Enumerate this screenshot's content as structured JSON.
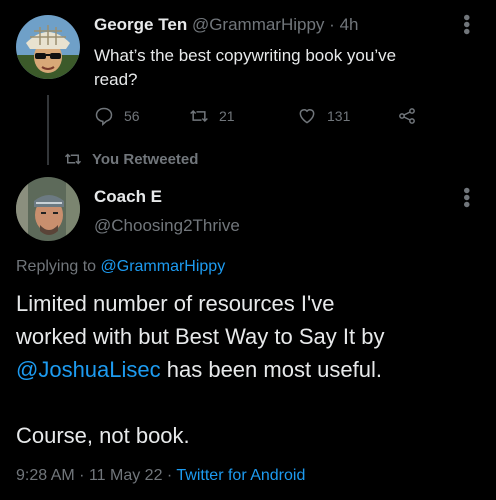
{
  "original_tweet": {
    "display_name": "George Ten",
    "handle": "@GrammarHippy",
    "separator": "·",
    "time": "4h",
    "text_line1": "What’s the best copywriting book you’ve",
    "text_line2": "read?",
    "actions": {
      "replies": "56",
      "retweets": "21",
      "likes": "131"
    }
  },
  "retweet_banner": {
    "label": "You Retweeted"
  },
  "reply_tweet": {
    "display_name": "Coach E",
    "handle": "@Choosing2Thrive",
    "replying_prefix": "Replying to",
    "replying_to": "@GrammarHippy",
    "body_line1": "Limited number of resources I've",
    "body_line2": "worked with but Best Way to Say It by",
    "mention": "@JoshuaLisec",
    "body_line3_rest": " has been most useful.",
    "body_line4": "Course, not book.",
    "footer": {
      "time": "9:28 AM",
      "sep1": "·",
      "date": "11 May 22",
      "sep2": "·",
      "source": "Twitter for Android"
    }
  },
  "colors": {
    "background": "#000000",
    "text": "#e7e9ea",
    "muted": "#71767b",
    "link": "#1d9bf0"
  },
  "icons": [
    "reply-icon",
    "retweet-icon",
    "like-icon",
    "share-icon",
    "more-icon"
  ]
}
